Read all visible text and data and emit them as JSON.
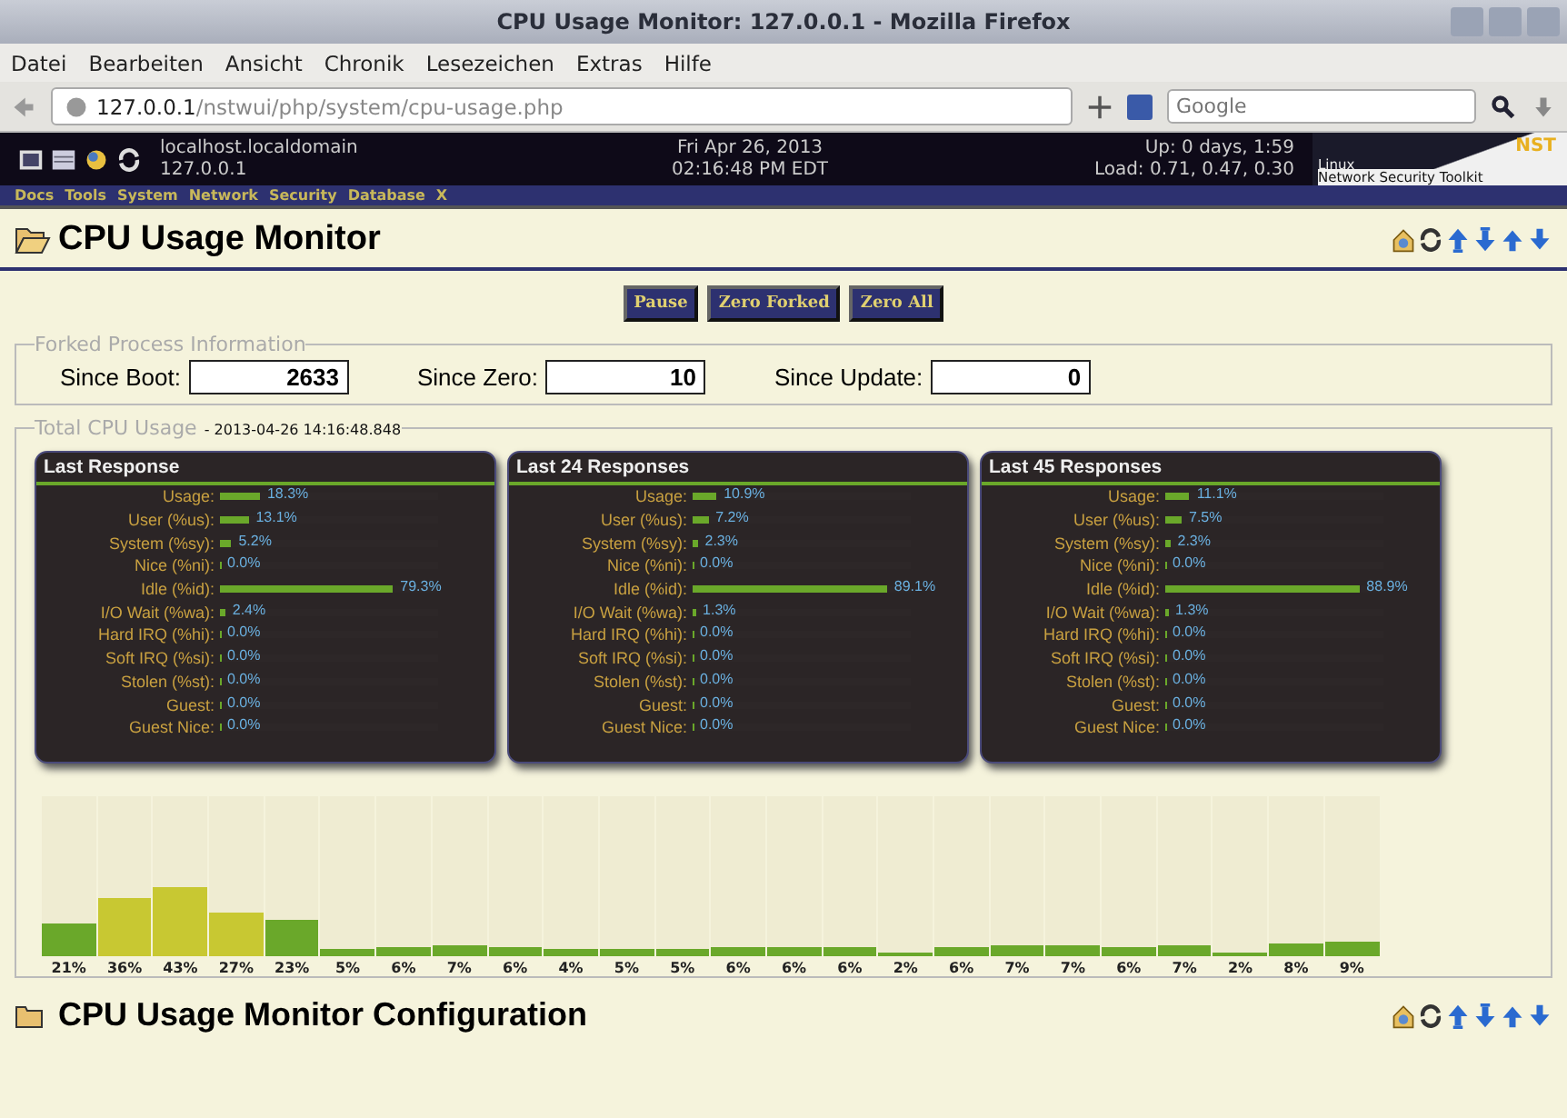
{
  "window": {
    "title": "CPU Usage Monitor: 127.0.0.1 - Mozilla Firefox"
  },
  "menu": [
    "Datei",
    "Bearbeiten",
    "Ansicht",
    "Chronik",
    "Lesezeichen",
    "Extras",
    "Hilfe"
  ],
  "url": {
    "host": "127.0.0.1",
    "path": "/nstwui/php/system/cpu-usage.php"
  },
  "search": {
    "placeholder": "Google"
  },
  "header": {
    "hostname": "localhost.localdomain",
    "ip": "127.0.0.1",
    "date": "Fri Apr 26, 2013",
    "time": "02:16:48 PM EDT",
    "uptime": "Up: 0 days, 1:59",
    "load": "Load: 0.71, 0.47, 0.30",
    "logo_line1": "Linux",
    "logo_line2": "Network Security Toolkit",
    "logo_brand": "NST"
  },
  "nav": [
    "Docs",
    "Tools",
    "System",
    "Network",
    "Security",
    "Database",
    "X"
  ],
  "page_title": "CPU Usage Monitor",
  "buttons": [
    "Pause",
    "Zero Forked",
    "Zero All"
  ],
  "forked": {
    "legend": "Forked Process Information",
    "fields": [
      {
        "label": "Since Boot:",
        "value": "2633"
      },
      {
        "label": "Since Zero:",
        "value": "10"
      },
      {
        "label": "Since Update:",
        "value": "0"
      }
    ]
  },
  "total": {
    "legend": "Total CPU Usage",
    "timestamp": "- 2013-04-26 14:16:48.848"
  },
  "panels": [
    {
      "title": "Last Response",
      "rows": [
        {
          "label": "Usage:",
          "level": 0.183,
          "reading": "18.3%"
        },
        {
          "label": "User (%us):",
          "level": 0.131,
          "reading": "13.1%"
        },
        {
          "label": "System (%sy):",
          "level": 0.052,
          "reading": "5.2%"
        },
        {
          "label": "Nice (%ni):",
          "level": 0,
          "reading": "0.0%"
        },
        {
          "label": "Idle (%id):",
          "level": 0.793,
          "reading": "79.3%"
        },
        {
          "label": "I/O Wait (%wa):",
          "level": 0.024,
          "reading": "2.4%"
        },
        {
          "label": "Hard IRQ (%hi):",
          "level": 0,
          "reading": "0.0%"
        },
        {
          "label": "Soft IRQ (%si):",
          "level": 0,
          "reading": "0.0%"
        },
        {
          "label": "Stolen (%st):",
          "level": 0,
          "reading": "0.0%"
        },
        {
          "label": "Guest:",
          "level": 0,
          "reading": "0.0%"
        },
        {
          "label": "Guest Nice:",
          "level": 0,
          "reading": "0.0%"
        }
      ]
    },
    {
      "title": "Last 24 Responses",
      "rows": [
        {
          "label": "Usage:",
          "level": 0.109,
          "reading": "10.9%"
        },
        {
          "label": "User (%us):",
          "level": 0.072,
          "reading": "7.2%"
        },
        {
          "label": "System (%sy):",
          "level": 0.023,
          "reading": "2.3%"
        },
        {
          "label": "Nice (%ni):",
          "level": 0,
          "reading": "0.0%"
        },
        {
          "label": "Idle (%id):",
          "level": 0.891,
          "reading": "89.1%"
        },
        {
          "label": "I/O Wait (%wa):",
          "level": 0.013,
          "reading": "1.3%"
        },
        {
          "label": "Hard IRQ (%hi):",
          "level": 0,
          "reading": "0.0%"
        },
        {
          "label": "Soft IRQ (%si):",
          "level": 0,
          "reading": "0.0%"
        },
        {
          "label": "Stolen (%st):",
          "level": 0,
          "reading": "0.0%"
        },
        {
          "label": "Guest:",
          "level": 0,
          "reading": "0.0%"
        },
        {
          "label": "Guest Nice:",
          "level": 0,
          "reading": "0.0%"
        }
      ]
    },
    {
      "title": "Last 45 Responses",
      "rows": [
        {
          "label": "Usage:",
          "level": 0.111,
          "reading": "11.1%"
        },
        {
          "label": "User (%us):",
          "level": 0.075,
          "reading": "7.5%"
        },
        {
          "label": "System (%sy):",
          "level": 0.023,
          "reading": "2.3%"
        },
        {
          "label": "Nice (%ni):",
          "level": 0,
          "reading": "0.0%"
        },
        {
          "label": "Idle (%id):",
          "level": 0.889,
          "reading": "88.9%"
        },
        {
          "label": "I/O Wait (%wa):",
          "level": 0.013,
          "reading": "1.3%"
        },
        {
          "label": "Hard IRQ (%hi):",
          "level": 0,
          "reading": "0.0%"
        },
        {
          "label": "Soft IRQ (%si):",
          "level": 0,
          "reading": "0.0%"
        },
        {
          "label": "Stolen (%st):",
          "level": 0,
          "reading": "0.0%"
        },
        {
          "label": "Guest:",
          "level": 0,
          "reading": "0.0%"
        },
        {
          "label": "Guest Nice:",
          "level": 0,
          "reading": "0.0%"
        }
      ]
    }
  ],
  "history": {
    "bars": [
      {
        "label": "21%",
        "level": 0.21
      },
      {
        "label": "36%",
        "level": 0.36
      },
      {
        "label": "43%",
        "level": 0.43
      },
      {
        "label": "27%",
        "level": 0.27
      },
      {
        "label": "23%",
        "level": 0.23
      },
      {
        "label": "5%",
        "level": 0.05
      },
      {
        "label": "6%",
        "level": 0.06
      },
      {
        "label": "7%",
        "level": 0.07
      },
      {
        "label": "6%",
        "level": 0.06
      },
      {
        "label": "4%",
        "level": 0.04
      },
      {
        "label": "5%",
        "level": 0.05
      },
      {
        "label": "5%",
        "level": 0.05
      },
      {
        "label": "6%",
        "level": 0.06
      },
      {
        "label": "6%",
        "level": 0.06
      },
      {
        "label": "6%",
        "level": 0.06
      },
      {
        "label": "2%",
        "level": 0.02
      },
      {
        "label": "6%",
        "level": 0.06
      },
      {
        "label": "7%",
        "level": 0.07
      },
      {
        "label": "7%",
        "level": 0.07
      },
      {
        "label": "6%",
        "level": 0.06
      },
      {
        "label": "7%",
        "level": 0.07
      },
      {
        "label": "2%",
        "level": 0.02
      },
      {
        "label": "8%",
        "level": 0.08
      },
      {
        "label": "9%",
        "level": 0.09
      }
    ]
  },
  "config_title": "CPU Usage Monitor Configuration"
}
